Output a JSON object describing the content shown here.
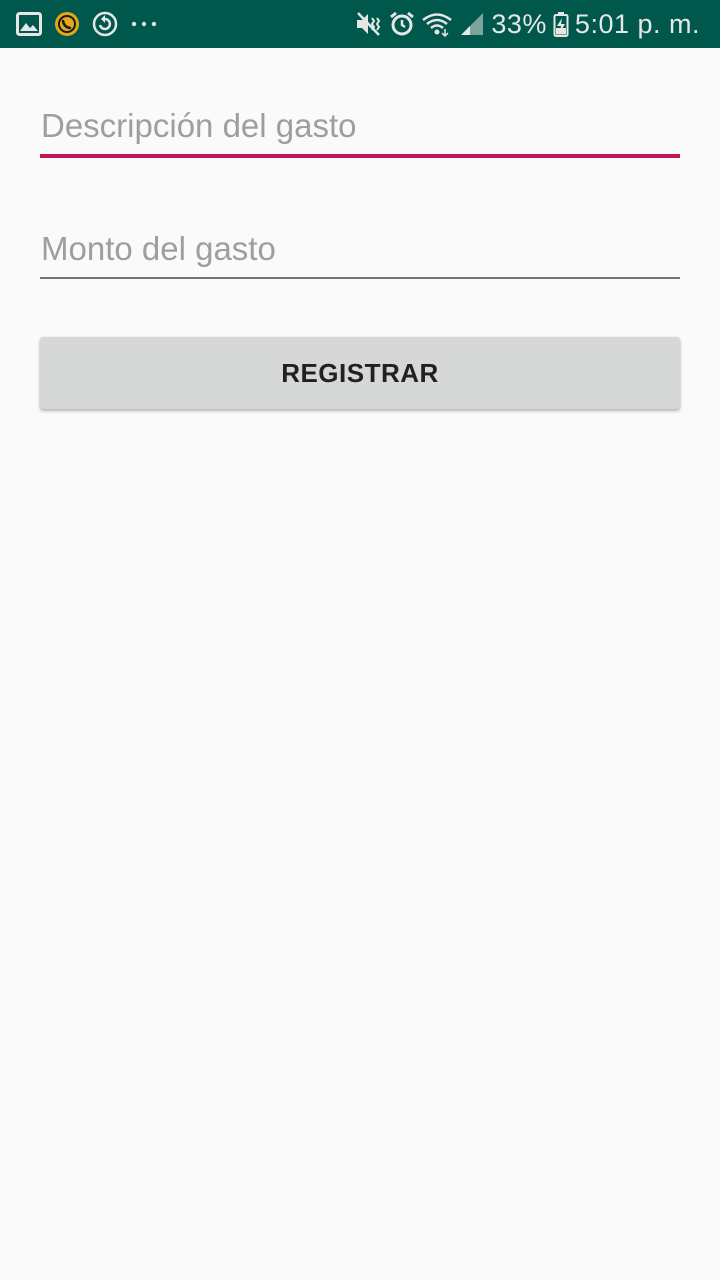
{
  "status_bar": {
    "background": "#00574b",
    "left_icons": [
      "gallery-icon",
      "whatsapp-icon",
      "sync-icon",
      "more-notifications-icon"
    ],
    "right_icons": [
      "vibrate-mute-icon",
      "alarm-icon",
      "wifi-icon",
      "signal-icon",
      "battery-charging-icon"
    ],
    "battery": "33%",
    "time": "5:01 p. m."
  },
  "form": {
    "description_placeholder": "Descripción del gasto",
    "description_value": "",
    "amount_placeholder": "Monto del gasto",
    "amount_value": "",
    "register_label": "REGISTRAR",
    "accent_color": "#c2185b"
  }
}
